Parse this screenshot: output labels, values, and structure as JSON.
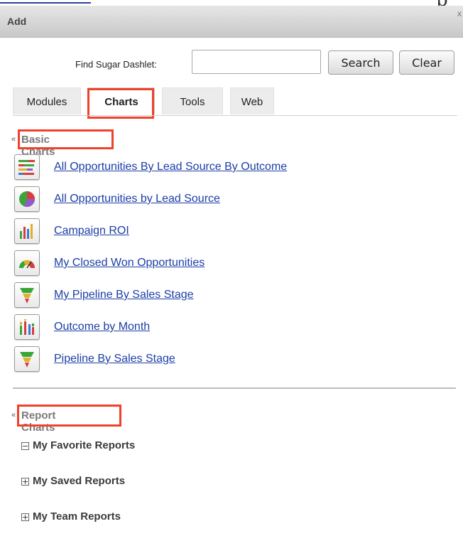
{
  "dialog": {
    "title": "Add",
    "close_glyph": "x"
  },
  "search": {
    "label": "Find Sugar Dashlet:",
    "value": "",
    "placeholder": "",
    "search_button": "Search",
    "clear_button": "Clear"
  },
  "tabs": [
    {
      "label": "Modules",
      "selected": false
    },
    {
      "label": "Charts",
      "selected": true
    },
    {
      "label": "Tools",
      "selected": false
    },
    {
      "label": "Web",
      "selected": false
    }
  ],
  "basic_charts": {
    "header": "Basic Charts",
    "items": [
      {
        "label": "All Opportunities By Lead Source By Outcome",
        "icon": "stacked-bar-chart-icon"
      },
      {
        "label": "All Opportunities by Lead Source",
        "icon": "pie-chart-icon"
      },
      {
        "label": "Campaign ROI",
        "icon": "bar-chart-icon"
      },
      {
        "label": "My Closed Won Opportunities",
        "icon": "gauge-chart-icon"
      },
      {
        "label": "My Pipeline By Sales Stage",
        "icon": "funnel-chart-icon"
      },
      {
        "label": "Outcome by Month",
        "icon": "grouped-bar-chart-icon"
      },
      {
        "label": "Pipeline By Sales Stage",
        "icon": "funnel-chart-icon"
      }
    ]
  },
  "report_charts": {
    "header": "Report Charts",
    "folders": [
      {
        "label": "My Favorite Reports",
        "expanded": true,
        "expander": "−"
      },
      {
        "label": "My Saved Reports",
        "expanded": false,
        "expander": "+"
      },
      {
        "label": "My Team Reports",
        "expanded": false,
        "expander": "+"
      }
    ]
  },
  "colors": {
    "highlight": "#f0412a",
    "link": "#1b3ea6",
    "section_header": "#7a7a7a"
  }
}
